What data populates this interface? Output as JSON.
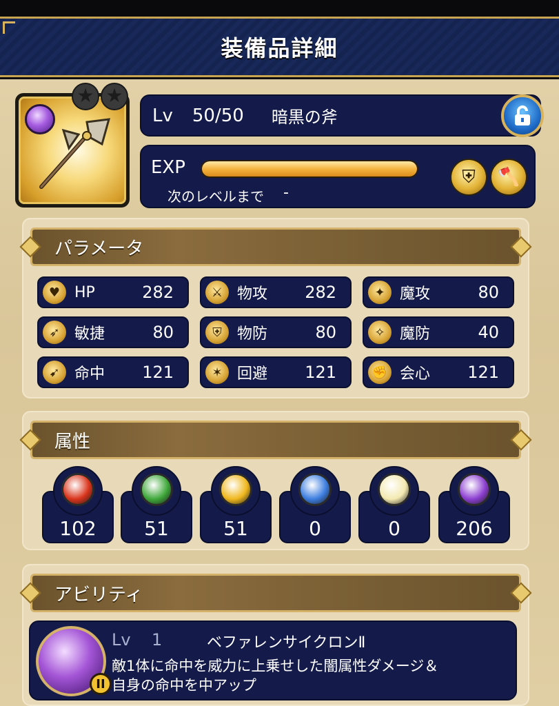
{
  "header": {
    "title": "装備品詳細"
  },
  "item": {
    "level_label": "Lv",
    "level_value": "50/50",
    "name": "暗黒の斧",
    "stars": [
      "★",
      "★"
    ],
    "lock_icon": "lock-open-icon",
    "exp_label": "EXP",
    "exp_progress": 1.0,
    "next_label": "次のレベルまで",
    "next_value": "-",
    "job_icons": [
      "shield-crest-icon",
      "axe-icon"
    ]
  },
  "parameters": {
    "title": "パラメータ",
    "stats": [
      {
        "label": "HP",
        "value": "282",
        "icon": "heart-icon"
      },
      {
        "label": "物攻",
        "value": "282",
        "icon": "sword-icon"
      },
      {
        "label": "魔攻",
        "value": "80",
        "icon": "wand-icon"
      },
      {
        "label": "敏捷",
        "value": "80",
        "icon": "boot-icon"
      },
      {
        "label": "物防",
        "value": "80",
        "icon": "shield-icon"
      },
      {
        "label": "魔防",
        "value": "40",
        "icon": "magic-shield-icon"
      },
      {
        "label": "命中",
        "value": "121",
        "icon": "bow-icon"
      },
      {
        "label": "回避",
        "value": "121",
        "icon": "dodge-icon"
      },
      {
        "label": "会心",
        "value": "121",
        "icon": "fist-icon"
      }
    ]
  },
  "attributes": {
    "title": "属性",
    "elements": [
      {
        "value": "102",
        "icon": "fire-orb-icon",
        "color": "#d9341b"
      },
      {
        "value": "51",
        "icon": "wind-orb-icon",
        "color": "#3fa83a"
      },
      {
        "value": "51",
        "icon": "thunder-orb-icon",
        "color": "#f0b81e"
      },
      {
        "value": "0",
        "icon": "ice-orb-icon",
        "color": "#3d7ee0"
      },
      {
        "value": "0",
        "icon": "light-orb-icon",
        "color": "#f3e9b0"
      },
      {
        "value": "206",
        "icon": "dark-orb-icon",
        "color": "#8c3fd0"
      }
    ]
  },
  "ability": {
    "title": "アビリティ",
    "level_label": "Lv",
    "level_value": "1",
    "name": "ベファレンサイクロンⅡ",
    "rank_badge": "II",
    "description_line1": "敵1体に命中を威力に上乗せした闇属性ダメージ＆",
    "description_line2": "自身の命中を中アップ"
  }
}
